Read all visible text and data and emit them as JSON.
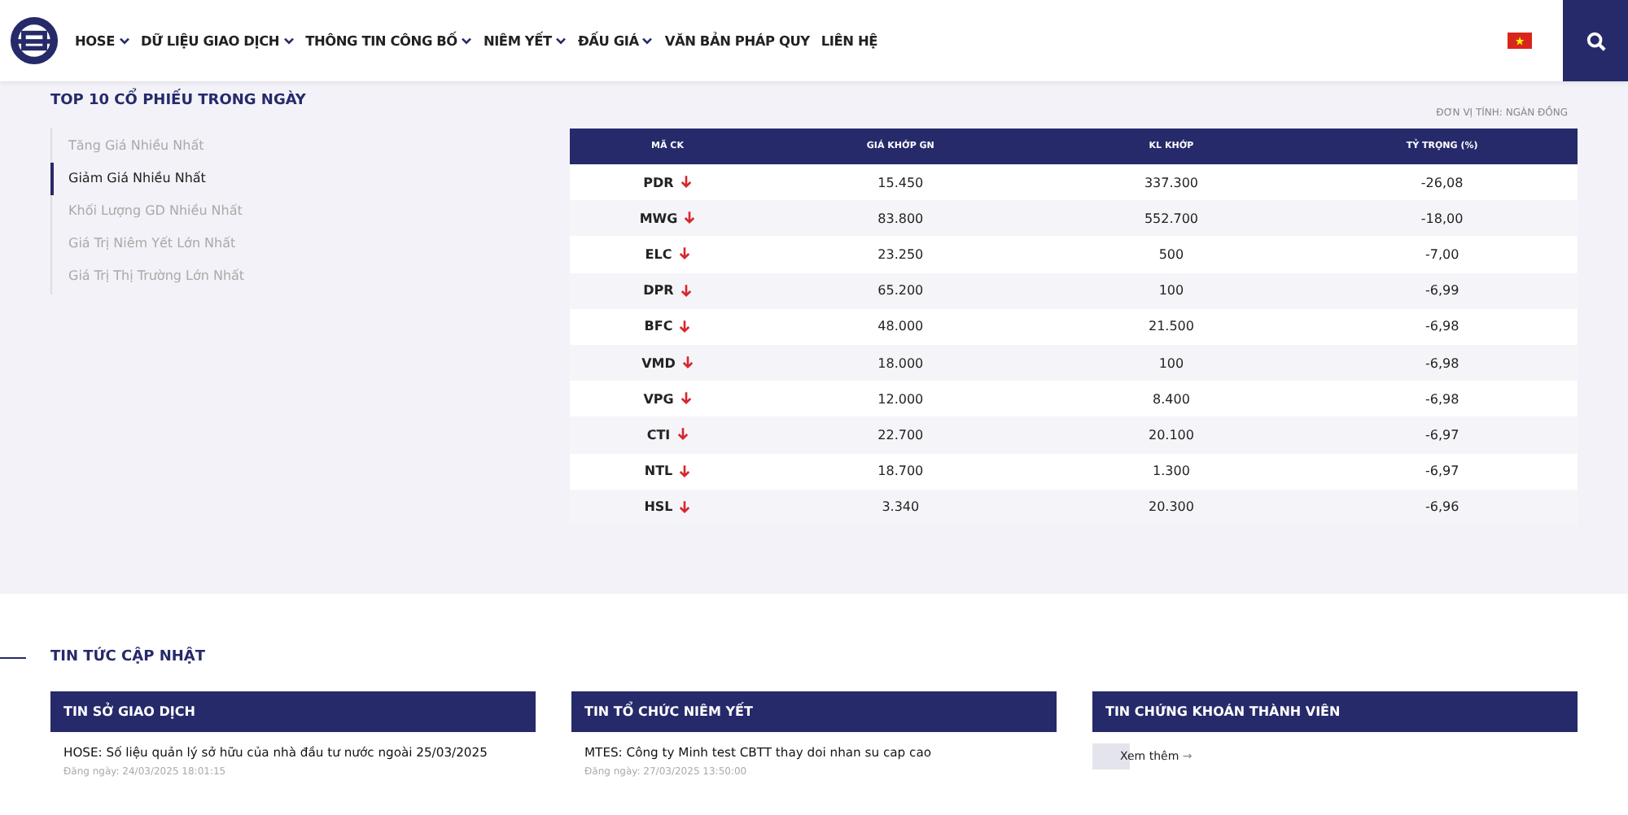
{
  "nav": {
    "items": [
      {
        "label": "HOSE",
        "dropdown": true
      },
      {
        "label": "DỮ LIỆU GIAO DỊCH",
        "dropdown": true
      },
      {
        "label": "THÔNG TIN CÔNG BỐ",
        "dropdown": true
      },
      {
        "label": "NIÊM YẾT",
        "dropdown": true
      },
      {
        "label": "ĐẤU GIÁ",
        "dropdown": true
      },
      {
        "label": "VĂN BẢN PHÁP QUY",
        "dropdown": false
      },
      {
        "label": "LIÊN HỆ",
        "dropdown": false
      }
    ]
  },
  "top_stocks": {
    "title": "TOP 10 CỔ PHIẾU TRONG NGÀY",
    "unit": "ĐƠN VỊ TÍNH: NGÀN ĐỒNG",
    "categories": [
      {
        "label": "Tăng Giá Nhiều Nhất",
        "selected": false
      },
      {
        "label": "Giảm Giá Nhiều Nhất",
        "selected": true
      },
      {
        "label": "Khối Lượng GD Nhiều Nhất",
        "selected": false
      },
      {
        "label": "Giá Trị Niêm Yết Lớn Nhất",
        "selected": false
      },
      {
        "label": "Giá Trị Thị Trường Lớn Nhất",
        "selected": false
      }
    ],
    "columns": [
      "MÃ CK",
      "GIÁ KHỚP GN",
      "KL KHỚP",
      "TỶ TRỌNG (%)"
    ],
    "rows": [
      {
        "code": "PDR",
        "price": "15.450",
        "volume": "337.300",
        "weight": "-26,08"
      },
      {
        "code": "MWG",
        "price": "83.800",
        "volume": "552.700",
        "weight": "-18,00"
      },
      {
        "code": "ELC",
        "price": "23.250",
        "volume": "500",
        "weight": "-7,00"
      },
      {
        "code": "DPR",
        "price": "65.200",
        "volume": "100",
        "weight": "-6,99"
      },
      {
        "code": "BFC",
        "price": "48.000",
        "volume": "21.500",
        "weight": "-6,98"
      },
      {
        "code": "VMD",
        "price": "18.000",
        "volume": "100",
        "weight": "-6,98"
      },
      {
        "code": "VPG",
        "price": "12.000",
        "volume": "8.400",
        "weight": "-6,98"
      },
      {
        "code": "CTI",
        "price": "22.700",
        "volume": "20.100",
        "weight": "-6,97"
      },
      {
        "code": "NTL",
        "price": "18.700",
        "volume": "1.300",
        "weight": "-6,97"
      },
      {
        "code": "HSL",
        "price": "3.340",
        "volume": "20.300",
        "weight": "-6,96"
      }
    ]
  },
  "news": {
    "title": "TIN TỨC CẬP NHẬT",
    "cards": [
      {
        "kind": "list",
        "title": "TIN SỞ GIAO DỊCH",
        "items": [
          {
            "headline": "HOSE: Số liệu quản lý sở hữu của nhà đầu tư nước ngoài 25/03/2025",
            "date": "Đăng ngày: 24/03/2025 18:01:15"
          }
        ]
      },
      {
        "kind": "list",
        "title": "TIN TỔ CHỨC NIÊM YẾT",
        "items": [
          {
            "headline": "MTES: Công ty Minh test CBTT thay doi nhan su cap cao",
            "date": "Đăng ngày: 27/03/2025 13:50:00"
          }
        ]
      },
      {
        "kind": "more",
        "title": "TIN CHỨNG KHOÁN THÀNH VIÊN",
        "more": "Xem thêm",
        "more_arrow": "→"
      }
    ]
  }
}
